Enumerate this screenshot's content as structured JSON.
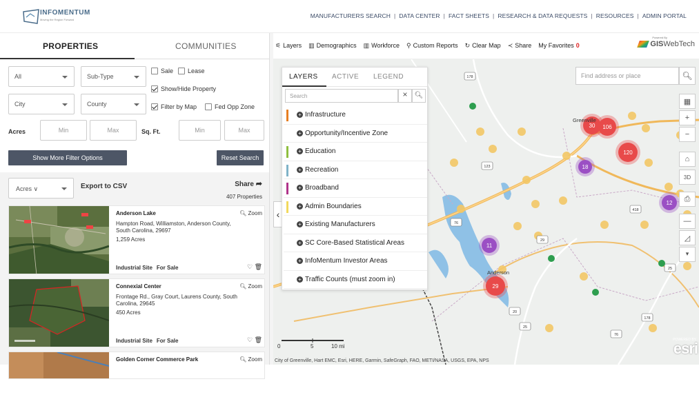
{
  "header": {
    "logo_text": "INFOMENTUM",
    "logo_tag": "Moving the Region Forward",
    "nav": [
      "MANUFACTURERS SEARCH",
      "DATA CENTER",
      "FACT SHEETS",
      "RESEARCH & DATA REQUESTS",
      "RESOURCES",
      "ADMIN PORTAL"
    ]
  },
  "left_tabs": {
    "properties": "PROPERTIES",
    "communities": "COMMUNITIES"
  },
  "filters": {
    "type": "All",
    "subtype": "Sub-Type",
    "city": "City",
    "county": "County",
    "sale": "Sale",
    "lease": "Lease",
    "show_hide": "Show/Hide Property",
    "filter_map": "Filter by Map",
    "fed_opp": "Fed Opp Zone",
    "acres_label": "Acres",
    "sqft_label": "Sq. Ft.",
    "min": "Min",
    "max": "Max",
    "more_button": "Show More Filter Options",
    "reset_button": "Reset Search"
  },
  "results": {
    "sort": "Acres ∨",
    "export": "Export to CSV",
    "share": "Share",
    "count": "407 Properties",
    "zoom": "Zoom",
    "cards": [
      {
        "title": "Anderson Lake",
        "address": "Hampton Road, Williamston, Anderson County, South Carolina, 29697",
        "acres": "1,259 Acres",
        "type": "Industrial Site",
        "status": "For Sale"
      },
      {
        "title": "Connexial Center",
        "address": "Frontage Rd., Gray Court, Laurens County, South Carolina, 29645",
        "acres": "450 Acres",
        "type": "Industrial Site",
        "status": "For Sale"
      },
      {
        "title": "Golden Corner Commerce Park",
        "address": "",
        "acres": "",
        "type": "",
        "status": ""
      }
    ]
  },
  "map_toolbar": {
    "layers": "Layers",
    "demographics": "Demographics",
    "workforce": "Workforce",
    "custom_reports": "Custom Reports",
    "clear_map": "Clear Map",
    "share": "Share",
    "favorites": "My Favorites",
    "favorites_count": "0",
    "brand": "GIS",
    "brand_suffix": "WebTech",
    "brand_tag": "Powered By"
  },
  "layers_panel": {
    "tabs": [
      "LAYERS",
      "ACTIVE",
      "LEGEND"
    ],
    "search_placeholder": "Search",
    "items": [
      {
        "label": "Infrastructure",
        "color": "#e67e22"
      },
      {
        "label": "Opportunity/Incentive Zone",
        "color": ""
      },
      {
        "label": "Education",
        "color": "#8fbf3f"
      },
      {
        "label": "Recreation",
        "color": "#7fb3c8"
      },
      {
        "label": "Broadband",
        "color": "#b0338a"
      },
      {
        "label": "Admin Boundaries",
        "color": "#f2d95c"
      },
      {
        "label": "Existing Manufacturers",
        "color": ""
      },
      {
        "label": "SC Core-Based Statistical Areas",
        "color": ""
      },
      {
        "label": "InfoMentum Investor Areas",
        "color": ""
      },
      {
        "label": "Traffic Counts (must zoom in)",
        "color": ""
      }
    ]
  },
  "map": {
    "find_placeholder": "Find address or place",
    "clusters": [
      {
        "label": "30",
        "color": "#e84a4a"
      },
      {
        "label": "106",
        "color": "#e84a4a"
      },
      {
        "label": "120",
        "color": "#e84a4a"
      },
      {
        "label": "18",
        "color": "#9b4fc4"
      },
      {
        "label": "12",
        "color": "#9b4fc4"
      },
      {
        "label": "11",
        "color": "#9b4fc4"
      },
      {
        "label": "29",
        "color": "#e84a4a"
      }
    ],
    "cities": [
      "Greenville",
      "Anderson"
    ],
    "roads": [
      "178",
      "123",
      "418",
      "76",
      "29",
      "20",
      "25",
      "178",
      "76",
      "25"
    ],
    "scale": {
      "zero": "0",
      "five": "5",
      "ten": "10 mi"
    },
    "attribution": "City of Greenville, Hart EMC, Esri, HERE, Garmin, SafeGraph, FAO, METI/NASA, USGS, EPA, NPS",
    "esri": "esri",
    "esri_tag": "POWERED BY"
  }
}
